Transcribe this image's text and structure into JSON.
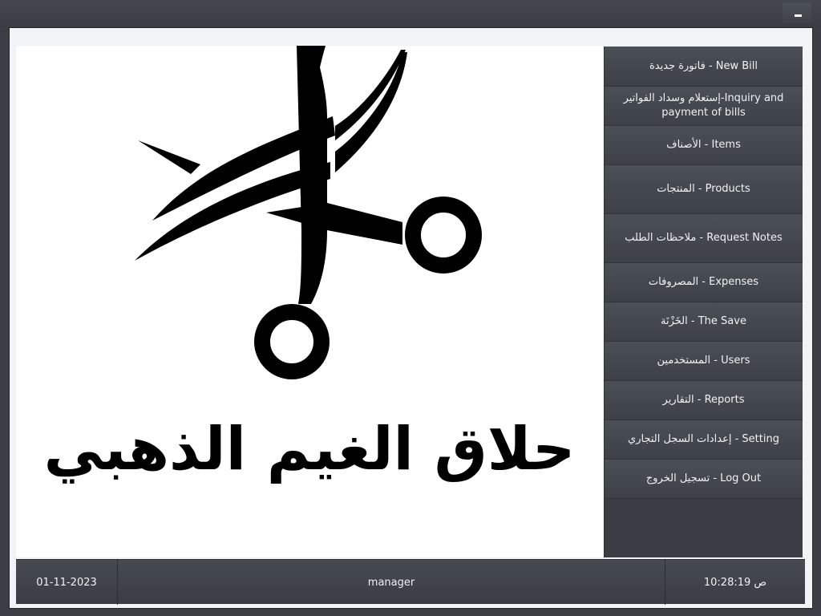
{
  "window": {
    "minimize_label": "minimize"
  },
  "logo": {
    "icon": "scissors-icon",
    "brand_text": "حلاق الغيم الذهبي"
  },
  "menu": {
    "items": [
      {
        "label": "فاتورة جديدة - New Bill"
      },
      {
        "label": "إستعلام وسداد الفواتير-Inquiry and payment of bills"
      },
      {
        "label": "الأصناف - Items"
      },
      {
        "label": "المنتجات - Products"
      },
      {
        "label": "ملاحظات الطلب - Request Notes"
      },
      {
        "label": "المصروفات - Expenses"
      },
      {
        "label": "الخَزْنَة - The Save"
      },
      {
        "label": "المستخدمين - Users"
      },
      {
        "label": "التقارير - Reports"
      },
      {
        "label": "إعدادات السجل التجاري - Setting"
      },
      {
        "label": "تسجيل الخروج - Log Out"
      }
    ]
  },
  "status": {
    "date": "01-11-2023",
    "user": "manager",
    "time": "10:28:19 ص"
  }
}
